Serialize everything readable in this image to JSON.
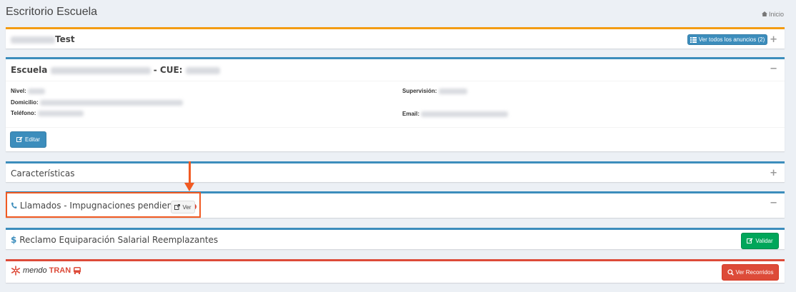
{
  "header": {
    "title": "Escritorio Escuela",
    "breadcrumb": "Inicio"
  },
  "announcements": {
    "title_suffix": "Test",
    "view_all_label": "Ver todos los anuncios (2)",
    "toggle": "+"
  },
  "school": {
    "title_prefix": "Escuela",
    "cue_label": "- CUE:",
    "toggle": "−",
    "fields": {
      "nivel": "Nivel:",
      "domicilio": "Domicilio:",
      "telefono": "Teléfono:",
      "supervision": "Supervisión:",
      "email": "Email:"
    },
    "edit_label": "Editar"
  },
  "features": {
    "title": "Características",
    "toggle": "+"
  },
  "calls": {
    "title": "Llamados - Impugnaciones pendientes",
    "badge": "0",
    "view_label": "Ver",
    "toggle": "−"
  },
  "claim": {
    "title": "Reclamo Equiparación Salarial Reemplazantes",
    "validate_label": "Validar"
  },
  "mendotran": {
    "logo_mendo": "mendo",
    "logo_tran": "TRAN",
    "routes_label": "Ver Recorridos"
  },
  "colors": {
    "primary": "#3c8dbc",
    "warning": "#f39c12",
    "danger": "#dd4b39",
    "success": "#00a65a",
    "highlight": "#f15a22"
  }
}
